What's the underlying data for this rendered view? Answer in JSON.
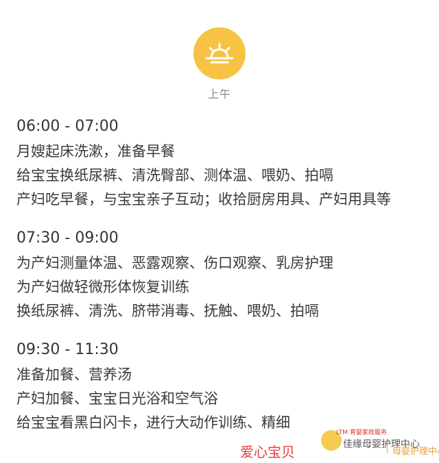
{
  "header": {
    "icon": "sunrise-icon",
    "icon_color": "#f6c344",
    "label": "上午"
  },
  "schedule": [
    {
      "time": "06:00 - 07:00",
      "items": [
        "月嫂起床洗漱，准备早餐",
        "给宝宝换纸尿裤、清洗臀部、测体温、喂奶、拍嗝",
        "产妇吃早餐，与宝宝亲子互动；收拾厨房用具、产妇用具等"
      ]
    },
    {
      "time": "07:30 - 09:00",
      "items": [
        "为产妇测量体温、恶露观察、伤口观察、乳房护理",
        "为产妇做轻微形体恢复训练",
        "换纸尿裤、清洗、脐带消毒、抚触、喂奶、拍嗝"
      ]
    },
    {
      "time": "09:30 - 11:30",
      "items": [
        "准备加餐、营养汤",
        "产妇加餐、宝宝日光浴和空气浴",
        "给宝宝看黑白闪卡，进行大动作训练、精细"
      ]
    }
  ],
  "watermark": {
    "main": "爱心宝贝",
    "sub": "LTM 育婴家政服务",
    "middle": "佳缘母婴护理中心",
    "right": "母婴护理中心"
  }
}
